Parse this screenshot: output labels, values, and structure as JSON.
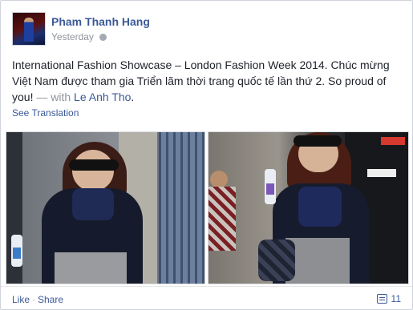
{
  "post": {
    "author": "Pham Thanh Hang",
    "timestamp": "Yesterday",
    "privacy_icon": "globe-icon",
    "text": "International Fashion Showcase – London Fashion Week 2014. Chúc mừng Việt Nam được tham gia Triển lãm thời trang quốc tế lần thứ 2. So proud of you!",
    "with_label": "— with",
    "tagged_user": "Le Anh Tho",
    "end_punct": ".",
    "see_translation": "See Translation"
  },
  "photos": [
    {
      "semantic": "woman in black coat and sunglasses holding water bottle"
    },
    {
      "semantic": "woman in black coat with handbag walking on street"
    }
  ],
  "actions": {
    "like": "Like",
    "separator": "·",
    "share": "Share",
    "comment_icon": "comment-icon",
    "comment_count": "11"
  },
  "colors": {
    "link": "#3b5998",
    "muted": "#90949c",
    "text": "#1d2129"
  }
}
